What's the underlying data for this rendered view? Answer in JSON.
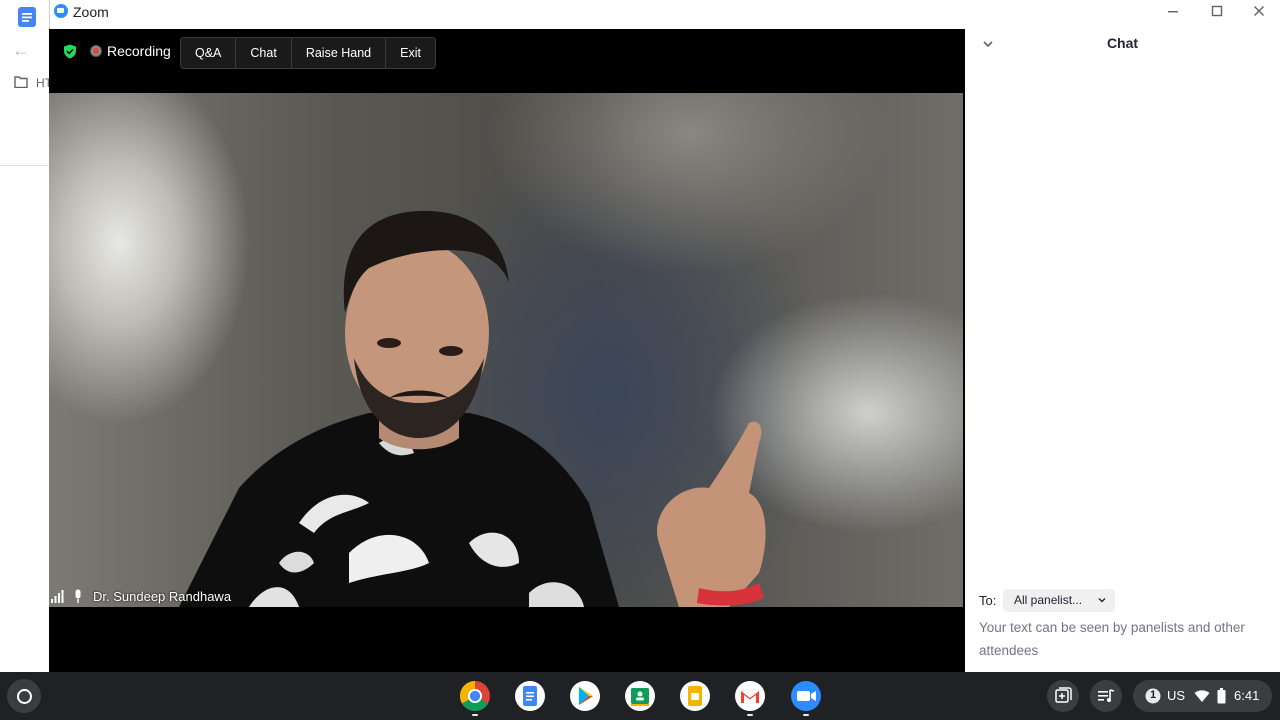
{
  "window": {
    "title": "Zoom",
    "icon": "zoom-logo-icon",
    "controls": [
      "minimize-icon",
      "maximize-icon",
      "close-icon"
    ]
  },
  "background_app": {
    "icon": "docs-icon",
    "truncated_text": "HT"
  },
  "meeting": {
    "recording_label": "Recording",
    "toolbar_buttons": [
      "Q&A",
      "Chat",
      "Raise Hand",
      "Exit"
    ],
    "participant_name": "Dr. Sundeep Randhawa"
  },
  "chat": {
    "title": "Chat",
    "to_label": "To:",
    "recipient": "All panelist...",
    "hint": "Your text can be seen by panelists and other attendees"
  },
  "shelf": {
    "apps": [
      "chrome-icon",
      "docs-icon",
      "play-store-icon",
      "classroom-icon",
      "slides-icon",
      "gmail-icon",
      "zoom-icon"
    ],
    "notification_count": "1",
    "keyboard_layout": "US",
    "time": "6:41"
  },
  "colors": {
    "zoom_blue": "#2d8cff",
    "meeting_bg": "#000000",
    "shelf_bg": "#202124",
    "shield_green": "#23d959",
    "recording_red": "#e0473a"
  }
}
